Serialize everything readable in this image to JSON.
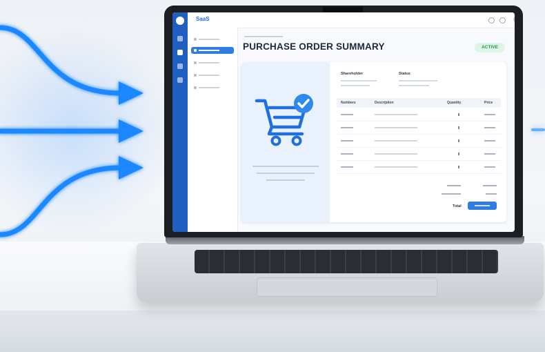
{
  "app": {
    "brand": "SaaS",
    "page_title": "PURCHASE ORDER SUMMARY",
    "status_badge": "ACTIVE"
  },
  "info_blocks": [
    {
      "heading": "Shareholder"
    },
    {
      "heading": "Status"
    }
  ],
  "table": {
    "columns": [
      "Numbers",
      "Description",
      "Quantity",
      "Price"
    ],
    "row_count": 5
  },
  "summary": {
    "total_label": "Total"
  },
  "colors": {
    "accent": "#2f7de1",
    "rail": "#1f5fbf",
    "badge_text": "#1f9a4b",
    "badge_bg": "#dff5e6",
    "arrow": "#1e88ff"
  },
  "icons": [
    "cart-icon",
    "check-icon",
    "arrow-icon"
  ]
}
